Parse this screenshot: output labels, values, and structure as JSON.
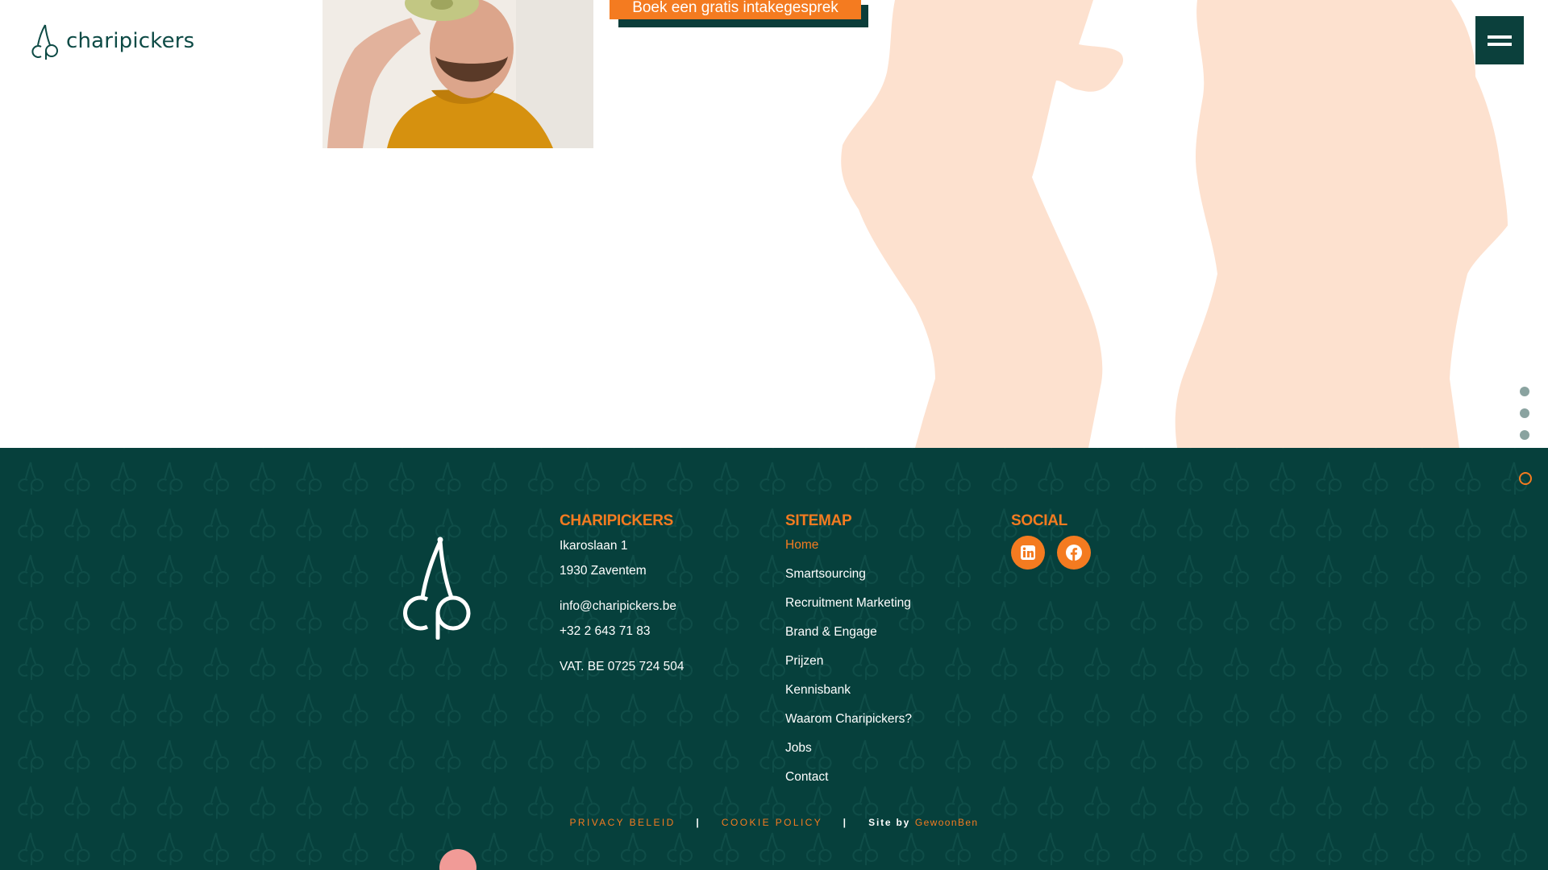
{
  "brand": {
    "name": "charipickers",
    "accent": "#f47b20",
    "dark": "#06403c"
  },
  "hero": {
    "cta_label": "Boek een gratis intakegesprek"
  },
  "menu": {
    "icon": "hamburger-icon"
  },
  "footer": {
    "company": {
      "heading": "CHARIPICKERS",
      "street": "Ikaroslaan 1",
      "city": "1930 Zaventem",
      "email": "info@charipickers.be",
      "phone": "+32 2 643 71 83",
      "vat": "VAT. BE 0725 724 504"
    },
    "sitemap": {
      "heading": "SITEMAP",
      "items": [
        {
          "label": "Home"
        },
        {
          "label": "Smartsourcing"
        },
        {
          "label": "Recruitment Marketing"
        },
        {
          "label": "Brand & Engage"
        },
        {
          "label": "Prijzen"
        },
        {
          "label": "Kennisbank"
        },
        {
          "label": "Waarom Charipickers?"
        },
        {
          "label": "Jobs"
        },
        {
          "label": "Contact"
        }
      ]
    },
    "social": {
      "heading": "SOCIAL",
      "icons": [
        "linkedin-icon",
        "facebook-icon"
      ]
    },
    "legal": {
      "privacy": "PRIVACY BELEID",
      "separator": "|",
      "cookie": "COOKIE POLICY",
      "site_by": "Site by",
      "credit": "GewoonBen"
    }
  }
}
